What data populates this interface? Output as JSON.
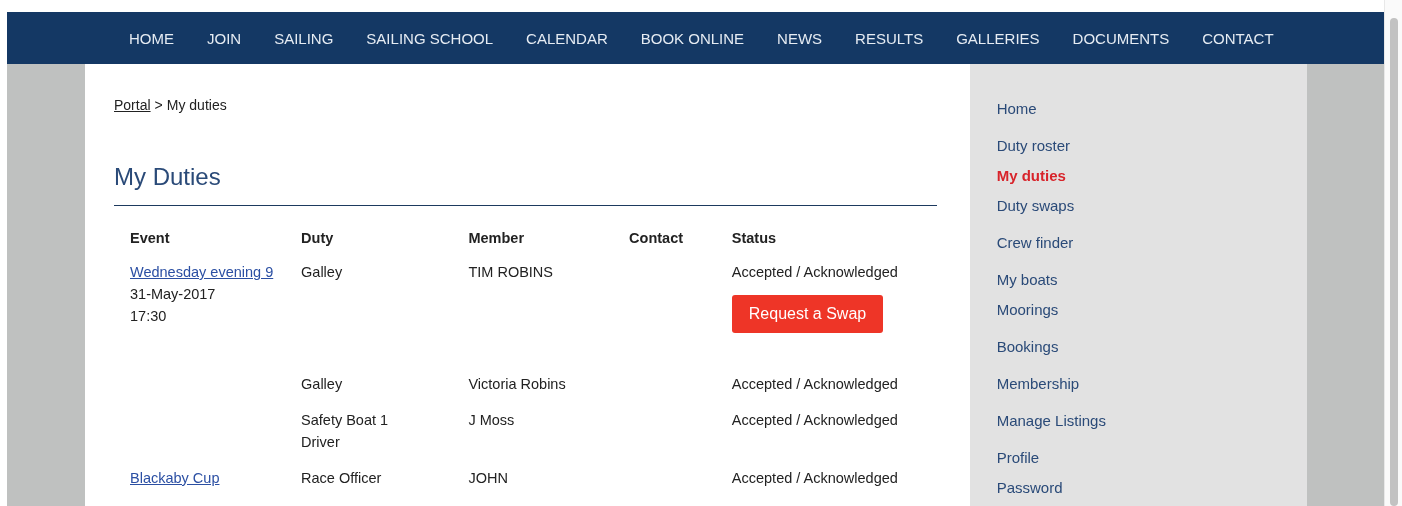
{
  "nav": [
    {
      "label": "HOME"
    },
    {
      "label": "JOIN"
    },
    {
      "label": "SAILING"
    },
    {
      "label": "SAILING SCHOOL"
    },
    {
      "label": "CALENDAR"
    },
    {
      "label": "BOOK ONLINE"
    },
    {
      "label": "NEWS"
    },
    {
      "label": "RESULTS"
    },
    {
      "label": "GALLERIES"
    },
    {
      "label": "DOCUMENTS"
    },
    {
      "label": "CONTACT"
    }
  ],
  "breadcrumb": {
    "link": "Portal",
    "separator": ">",
    "current": "My duties"
  },
  "heading": "My Duties",
  "table": {
    "columns": [
      "Event",
      "Duty",
      "Member",
      "Contact",
      "Status"
    ],
    "rows": [
      {
        "event": "Wednesday evening 9",
        "date": "31-May-2017",
        "time": "17:30",
        "duty": "Galley",
        "member": "TIM ROBINS",
        "status": "Accepted / Acknowledged",
        "action": "Request a Swap"
      },
      {
        "duty": "Galley",
        "member": "Victoria Robins",
        "status": "Accepted / Acknowledged"
      },
      {
        "duty": "Safety Boat 1 Driver",
        "member": "J Moss",
        "status": "Accepted / Acknowledged"
      },
      {
        "event": "Blackaby Cup",
        "duty": "Race Officer",
        "member": "JOHN",
        "status": "Accepted / Acknowledged"
      }
    ]
  },
  "sidebar": {
    "groups": [
      [
        {
          "label": "Home",
          "selected": false
        }
      ],
      [
        {
          "label": "Duty roster",
          "selected": false
        },
        {
          "label": "My duties",
          "selected": true
        },
        {
          "label": "Duty swaps",
          "selected": false
        }
      ],
      [
        {
          "label": "Crew finder",
          "selected": false
        }
      ],
      [
        {
          "label": "My boats",
          "selected": false
        },
        {
          "label": "Moorings",
          "selected": false
        }
      ],
      [
        {
          "label": "Bookings",
          "selected": false
        }
      ],
      [
        {
          "label": "Membership",
          "selected": false
        }
      ],
      [
        {
          "label": "Manage Listings",
          "selected": false
        }
      ],
      [
        {
          "label": "Profile",
          "selected": false
        },
        {
          "label": "Password",
          "selected": false
        }
      ]
    ]
  }
}
